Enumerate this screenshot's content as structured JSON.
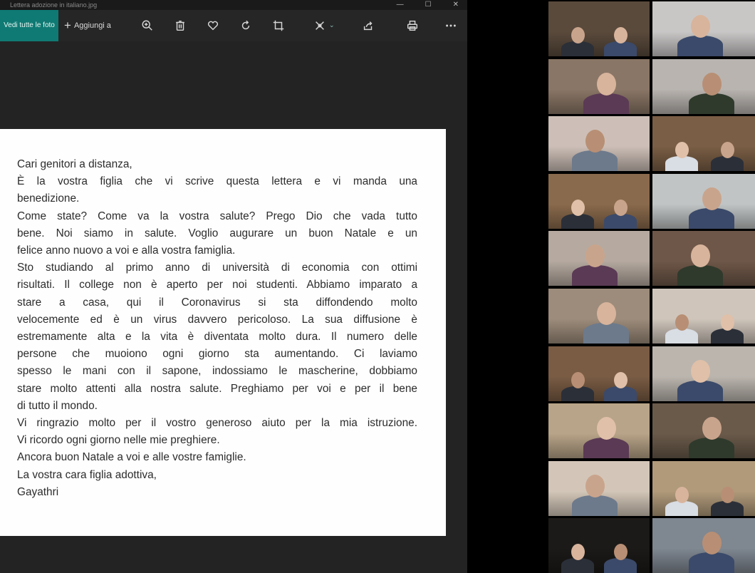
{
  "window": {
    "title": "Lettera adozione in italiano.jpg",
    "controls": [
      "—",
      "☐",
      "✕"
    ]
  },
  "toolbar": {
    "see_all_label": "Vedi tutte le foto",
    "add_label": "Aggiungi a",
    "icons": [
      "zoom-in-icon",
      "delete-icon",
      "favorite-icon",
      "rotate-icon",
      "crop-icon",
      "enhance-icon",
      "share-icon",
      "print-icon",
      "more-icon"
    ]
  },
  "letter": {
    "lines": [
      "Cari genitori a distanza,",
      "È la vostra figlia che vi scrive questa lettera e vi manda una",
      "benedizione.",
      "Come state? Come va la vostra salute? Prego Dio che vada tutto",
      "bene. Noi siamo in salute. Voglio augurare un buon Natale e un",
      "felice anno nuovo a voi e alla vostra famiglia.",
      "Sto studiando al primo anno di università di economia con ottimi",
      "risultati. Il college non è aperto per noi studenti. Abbiamo imparato a",
      "stare a casa, qui il Coronavirus si sta diffondendo molto",
      "velocemente ed è un virus davvero pericoloso. La sua diffusione è",
      "estremamente alta e la vita è diventata molto dura. Il numero delle",
      "persone che muoiono ogni giorno sta aumentando. Ci laviamo",
      "spesso le mani con il sapone, indossiamo le mascherine, dobbiamo",
      "stare molto attenti alla nostra salute. Preghiamo per voi e per il bene",
      "di tutto il mondo.",
      "Vi ringrazio molto per il vostro generoso aiuto per la mia istruzione.",
      "Vi ricordo ogni giorno nelle mie preghiere.",
      "Ancora buon Natale a voi e alle vostre famiglie.",
      "La vostra cara figlia adottiva,",
      "Gayathri"
    ],
    "justified": [
      false,
      true,
      false,
      true,
      true,
      false,
      true,
      true,
      true,
      true,
      true,
      true,
      true,
      true,
      false,
      true,
      false,
      false,
      false,
      false
    ]
  },
  "gallery": {
    "columns": 2,
    "rows": 10,
    "tile_colors": [
      [
        "#5a4a3c",
        "#c9c7c6"
      ],
      [
        "#8a7666",
        "#b9b4b0"
      ],
      [
        "#cdbfb7",
        "#7a5e45"
      ],
      [
        "#8a6a4c",
        "#c0c4c4"
      ],
      [
        "#b6aaa0",
        "#6e5748"
      ],
      [
        "#9d8c7b",
        "#cfc5bb"
      ],
      [
        "#7a5c44",
        "#bbb5ae"
      ],
      [
        "#b8a488",
        "#6a5a4a"
      ],
      [
        "#d3c6b8",
        "#b09a7a"
      ],
      [
        "#1c1a18",
        "#7f8791"
      ]
    ]
  }
}
